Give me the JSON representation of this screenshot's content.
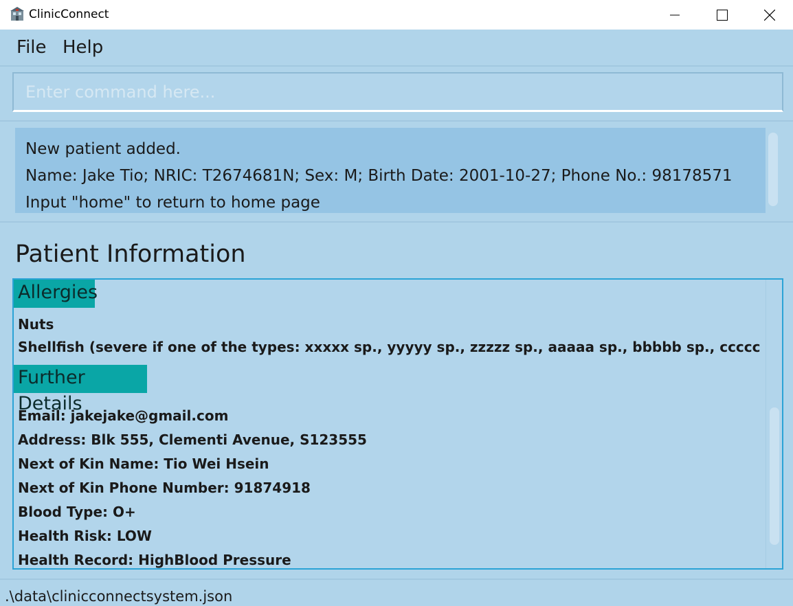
{
  "window": {
    "title": "ClinicConnect",
    "icon": "clinic-building-icon"
  },
  "menu": {
    "file_label": "File",
    "help_label": "Help"
  },
  "command": {
    "placeholder": "Enter command here...",
    "value": ""
  },
  "result": {
    "lines": [
      "New patient added.",
      "Name: Jake Tio; NRIC: T2674681N; Sex: M; Birth Date: 2001-10-27; Phone No.: 98178571",
      "Input \"home\" to return to home page"
    ]
  },
  "patient": {
    "section_title": "Patient Information",
    "allergies_heading": "Allergies",
    "allergies": [
      "Nuts",
      "Shellfish (severe if one of the types: xxxxx sp., yyyyy sp., zzzzz sp., aaaaa sp., bbbbb sp., ccccc sp., ddddd sp., e"
    ],
    "further_heading": "Further Details",
    "details": [
      "Email: jakejake@gmail.com",
      "Address: Blk 555, Clementi Avenue, S123555",
      "Next of Kin Name: Tio Wei Hsein",
      "Next of Kin Phone Number: 91874918",
      "Blood Type: O+",
      "Health Risk: LOW",
      "Health Record: HighBlood Pressure"
    ]
  },
  "status": {
    "file_path": ".\\data\\clinicconnectsystem.json"
  },
  "colors": {
    "background": "#b0d4ea",
    "result_box": "#95c4e4",
    "section_heading": "#0aa6a6",
    "panel_border": "#2ba3d6"
  }
}
